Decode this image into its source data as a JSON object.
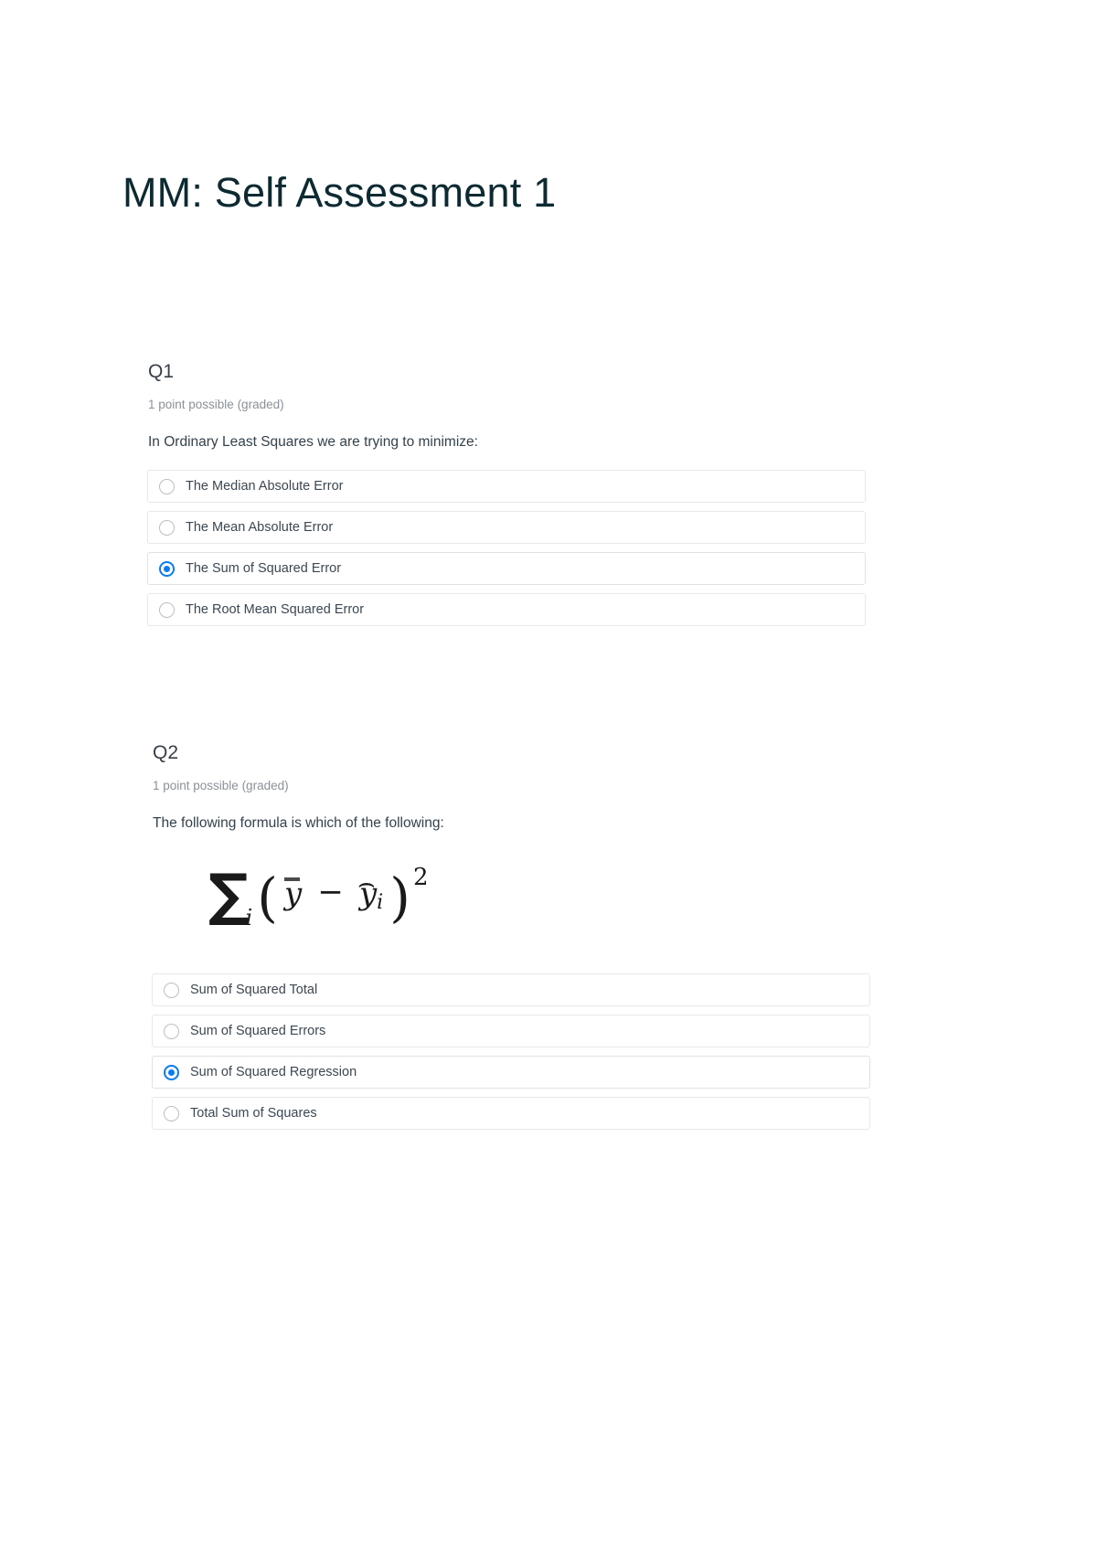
{
  "document": {
    "title": "MM: Self Assessment 1",
    "accent_color": "#0a7cf0",
    "title_color": "#0d2a33",
    "option_border_color": "#e6e8ea"
  },
  "questions": [
    {
      "heading": "Q1",
      "points": "1 point possible (graded)",
      "prompt": "In Ordinary Least Squares we are trying to minimize:",
      "options": [
        {
          "label": "The Median Absolute Error",
          "selected": false
        },
        {
          "label": "The Mean Absolute Error",
          "selected": false
        },
        {
          "label": "The Sum of Squared Error",
          "selected": true
        },
        {
          "label": "The Root Mean Squared Error",
          "selected": false
        }
      ]
    },
    {
      "heading": "Q2",
      "points": "1 point possible (graded)",
      "prompt": "The following formula is which of the following:",
      "formula": {
        "latex": "\\sum_i \\left( \\bar{y} - \\widehat{y_i} \\right)^2",
        "sigma": "∑",
        "sigma_subscript": "i",
        "open_paren": "(",
        "term_1": "y",
        "operator": "−",
        "term_2": "y",
        "term_2_subscript": "i",
        "term_2_hat": "⌢",
        "close_paren": ")",
        "exponent": "2"
      },
      "options": [
        {
          "label": "Sum of Squared Total",
          "selected": false
        },
        {
          "label": "Sum of Squared Errors",
          "selected": false
        },
        {
          "label": "Sum of Squared Regression",
          "selected": true
        },
        {
          "label": "Total Sum of Squares",
          "selected": false
        }
      ]
    }
  ]
}
